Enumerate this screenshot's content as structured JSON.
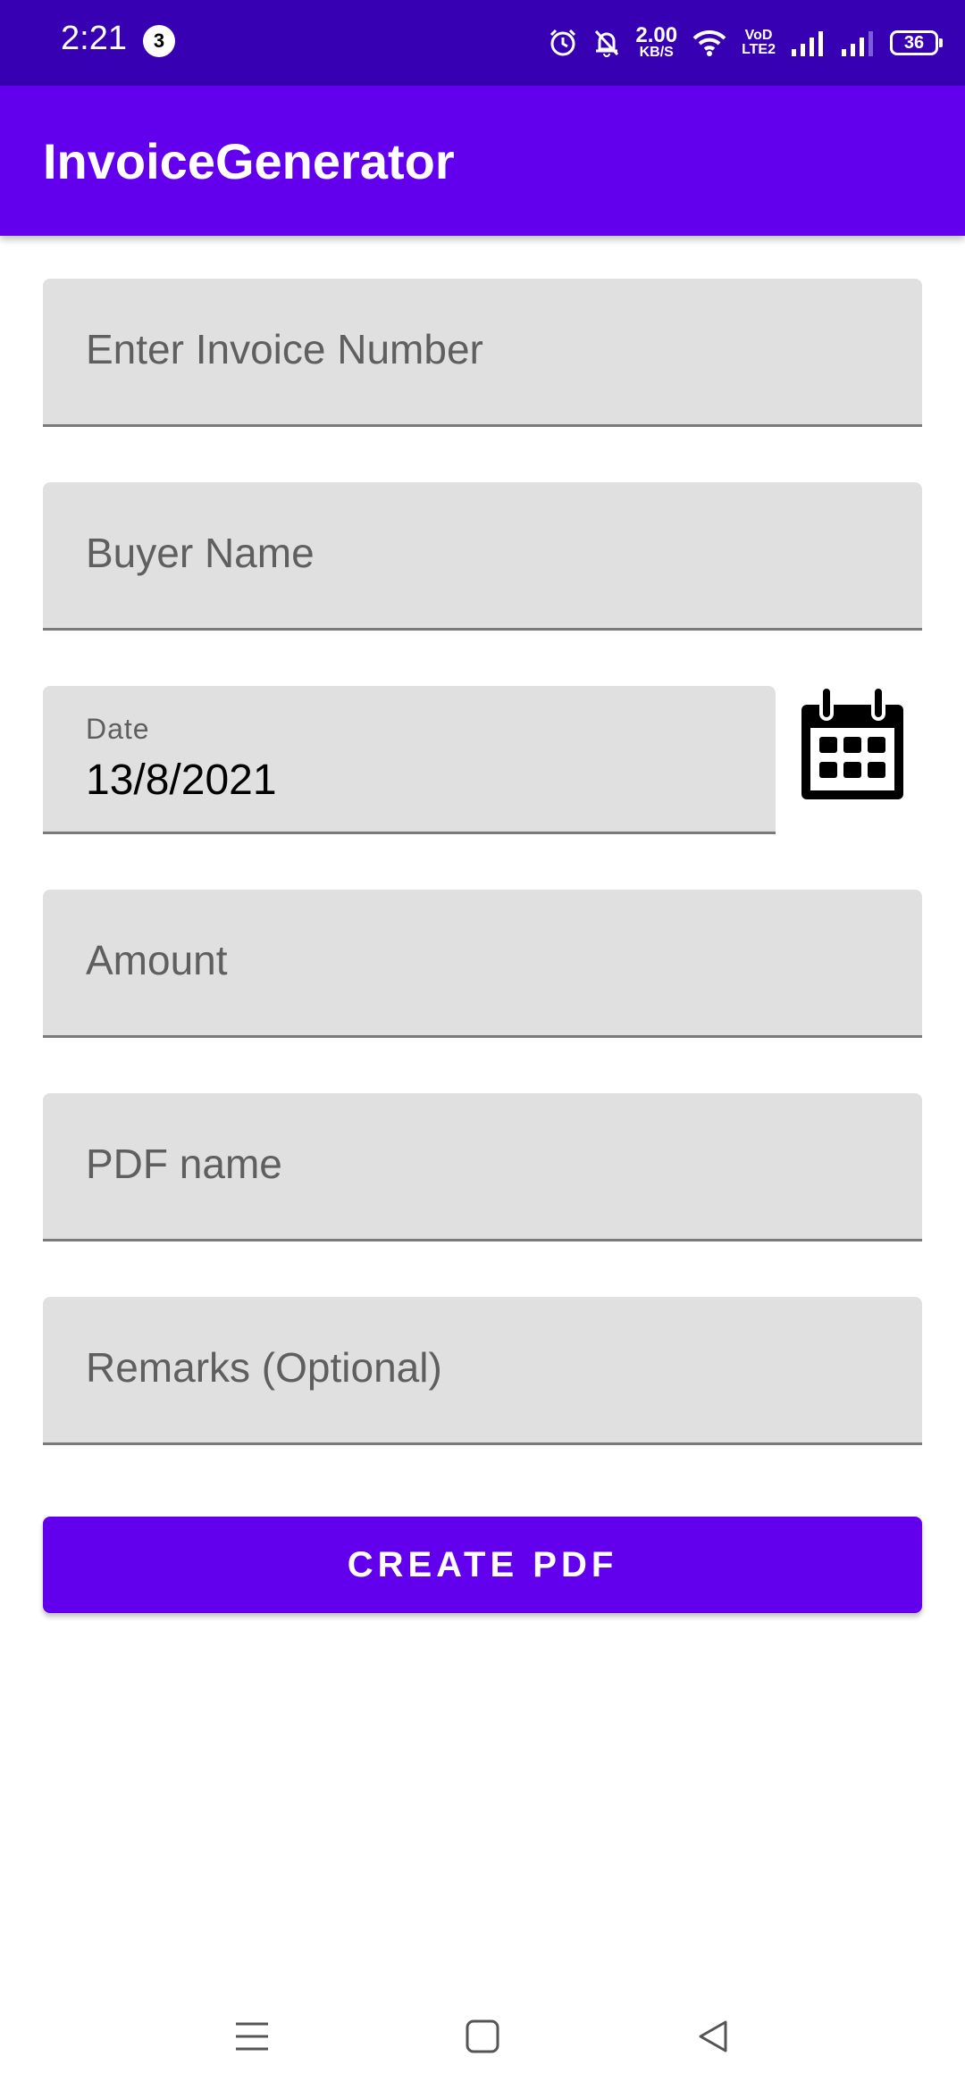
{
  "status_bar": {
    "time": "2:21",
    "notification_count": "3",
    "net_speed": "2.00",
    "net_speed_unit": "KB/S",
    "volte_line1": "VoD",
    "volte_line2": "LTE2",
    "battery_level": "36"
  },
  "app_bar": {
    "title": "InvoiceGenerator"
  },
  "form": {
    "invoice_number": {
      "placeholder": "Enter Invoice Number"
    },
    "buyer_name": {
      "placeholder": "Buyer Name"
    },
    "date": {
      "label": "Date",
      "value": "13/8/2021"
    },
    "amount": {
      "placeholder": "Amount"
    },
    "pdf_name": {
      "placeholder": "PDF name"
    },
    "remarks": {
      "placeholder": "Remarks (Optional)"
    }
  },
  "create_button": {
    "label": "CREATE PDF"
  },
  "icons": {
    "calendar": "calendar-icon",
    "nav_recents": "menu-icon",
    "nav_home": "square-icon",
    "nav_back": "triangle-back-icon"
  },
  "colors": {
    "primary": "#6200ee",
    "primary_dark": "#3700b3",
    "field_bg": "#e0e0e0"
  }
}
